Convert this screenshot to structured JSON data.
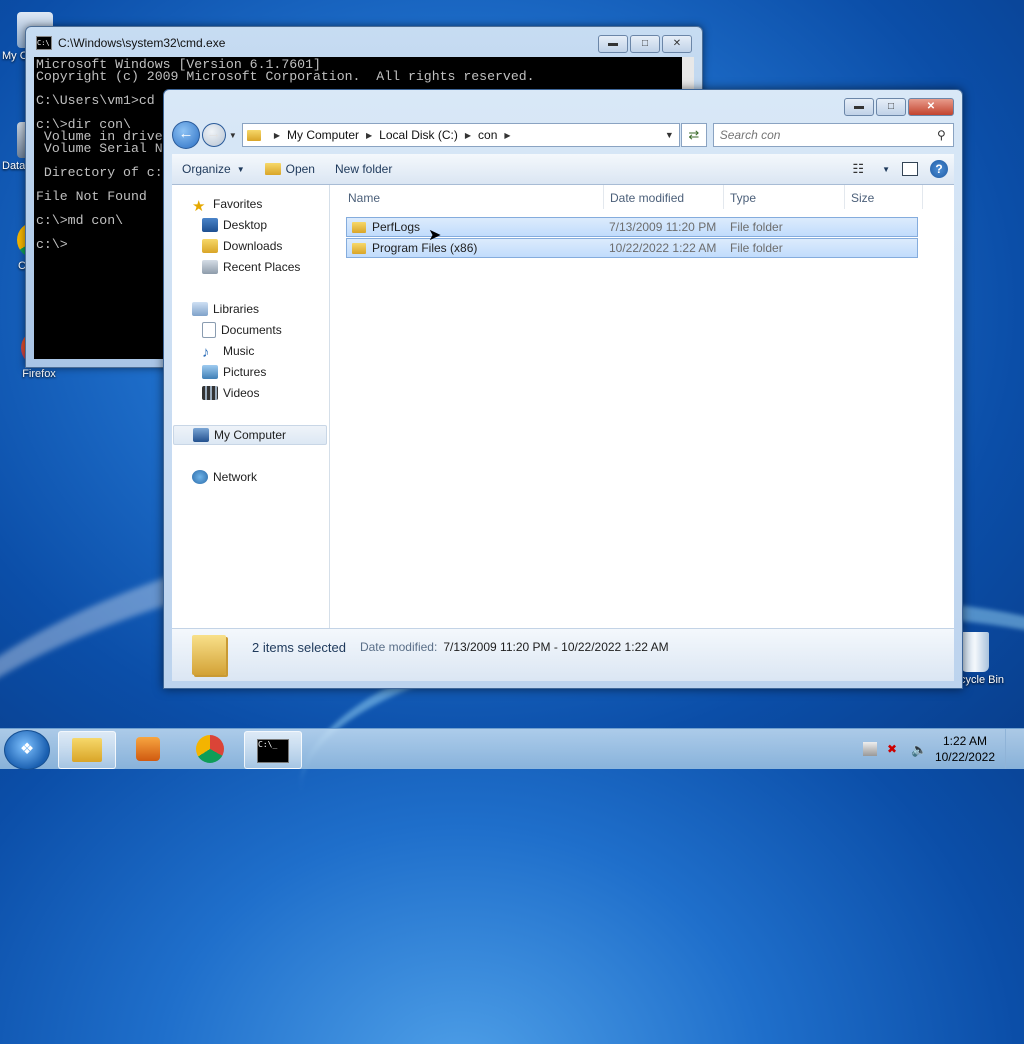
{
  "desktop": {
    "icons": [
      {
        "label": "My C",
        "name": "desktop-icon-my-computer"
      },
      {
        "label": "Data",
        "name": "desktop-icon-data"
      },
      {
        "label": "C",
        "name": "desktop-icon-chrome"
      },
      {
        "label": "Firefox",
        "name": "desktop-icon-firefox"
      },
      {
        "label": "Recycle Bin",
        "name": "desktop-icon-recycle-bin"
      }
    ]
  },
  "cmd": {
    "title": "C:\\Windows\\system32\\cmd.exe",
    "lines": [
      "Microsoft Windows [Version 6.1.7601]",
      "Copyright (c) 2009 Microsoft Corporation.  All rights reserved.",
      "",
      "C:\\Users\\vm1>cd",
      "",
      "c:\\>dir con\\",
      " Volume in drive",
      " Volume Serial N",
      "",
      " Directory of c:",
      "",
      "File Not Found",
      "",
      "c:\\>md con\\",
      "",
      "c:\\>"
    ]
  },
  "explorer": {
    "address": {
      "crumbs": [
        "My Computer",
        "Local Disk (C:)",
        "con"
      ]
    },
    "search": {
      "placeholder": "Search con"
    },
    "toolbar": {
      "organize": "Organize",
      "open": "Open",
      "new_folder": "New folder"
    },
    "nav": {
      "favorites": "Favorites",
      "desktop": "Desktop",
      "downloads": "Downloads",
      "recent": "Recent Places",
      "libraries": "Libraries",
      "documents": "Documents",
      "music": "Music",
      "pictures": "Pictures",
      "videos": "Videos",
      "computer": "My Computer",
      "network": "Network"
    },
    "columns": {
      "name": "Name",
      "date": "Date modified",
      "type": "Type",
      "size": "Size"
    },
    "files": [
      {
        "name": "PerfLogs",
        "date": "7/13/2009 11:20 PM",
        "type": "File folder"
      },
      {
        "name": "Program Files (x86)",
        "date": "10/22/2022 1:22 AM",
        "type": "File folder"
      }
    ],
    "details": {
      "count": "2 items selected",
      "label": "Date modified:",
      "value": "7/13/2009 11:20 PM - 10/22/2022 1:22 AM"
    }
  },
  "taskbar": {
    "time": "1:22 AM",
    "date": "10/22/2022"
  },
  "colors": {
    "selection": "#c1dcfc",
    "selection_border": "#84acdd",
    "link_text": "#1e395b"
  }
}
